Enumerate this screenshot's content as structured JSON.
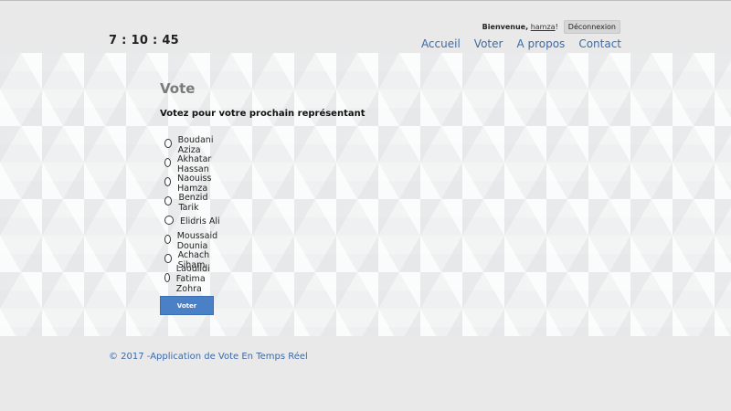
{
  "header": {
    "clock": "7 : 10 : 45",
    "welcome": "Bienvenue,",
    "username": "hamza",
    "separator": "!",
    "logout_label": "Déconnexion",
    "nav": [
      "Accueil",
      "Voter",
      "A propos",
      "Contact"
    ]
  },
  "main": {
    "title": "Vote",
    "subtitle": "Votez pour votre prochain représentant",
    "candidates": [
      "Boudani Aziza",
      "Akhatar Hassan",
      "Naouiss Hamza",
      "Benzid Tarik",
      "Elidris Ali",
      "Moussaid Dounia",
      "Achach Siham",
      "Laoulidi Fatima Zohra"
    ],
    "submit_label": "Voter"
  },
  "footer": {
    "text": "© 2017 -Application de Vote En Temps Réel"
  },
  "colors": {
    "link": "#3d6aa8",
    "button": "#4a80c6",
    "background": "#e9e9e9"
  }
}
